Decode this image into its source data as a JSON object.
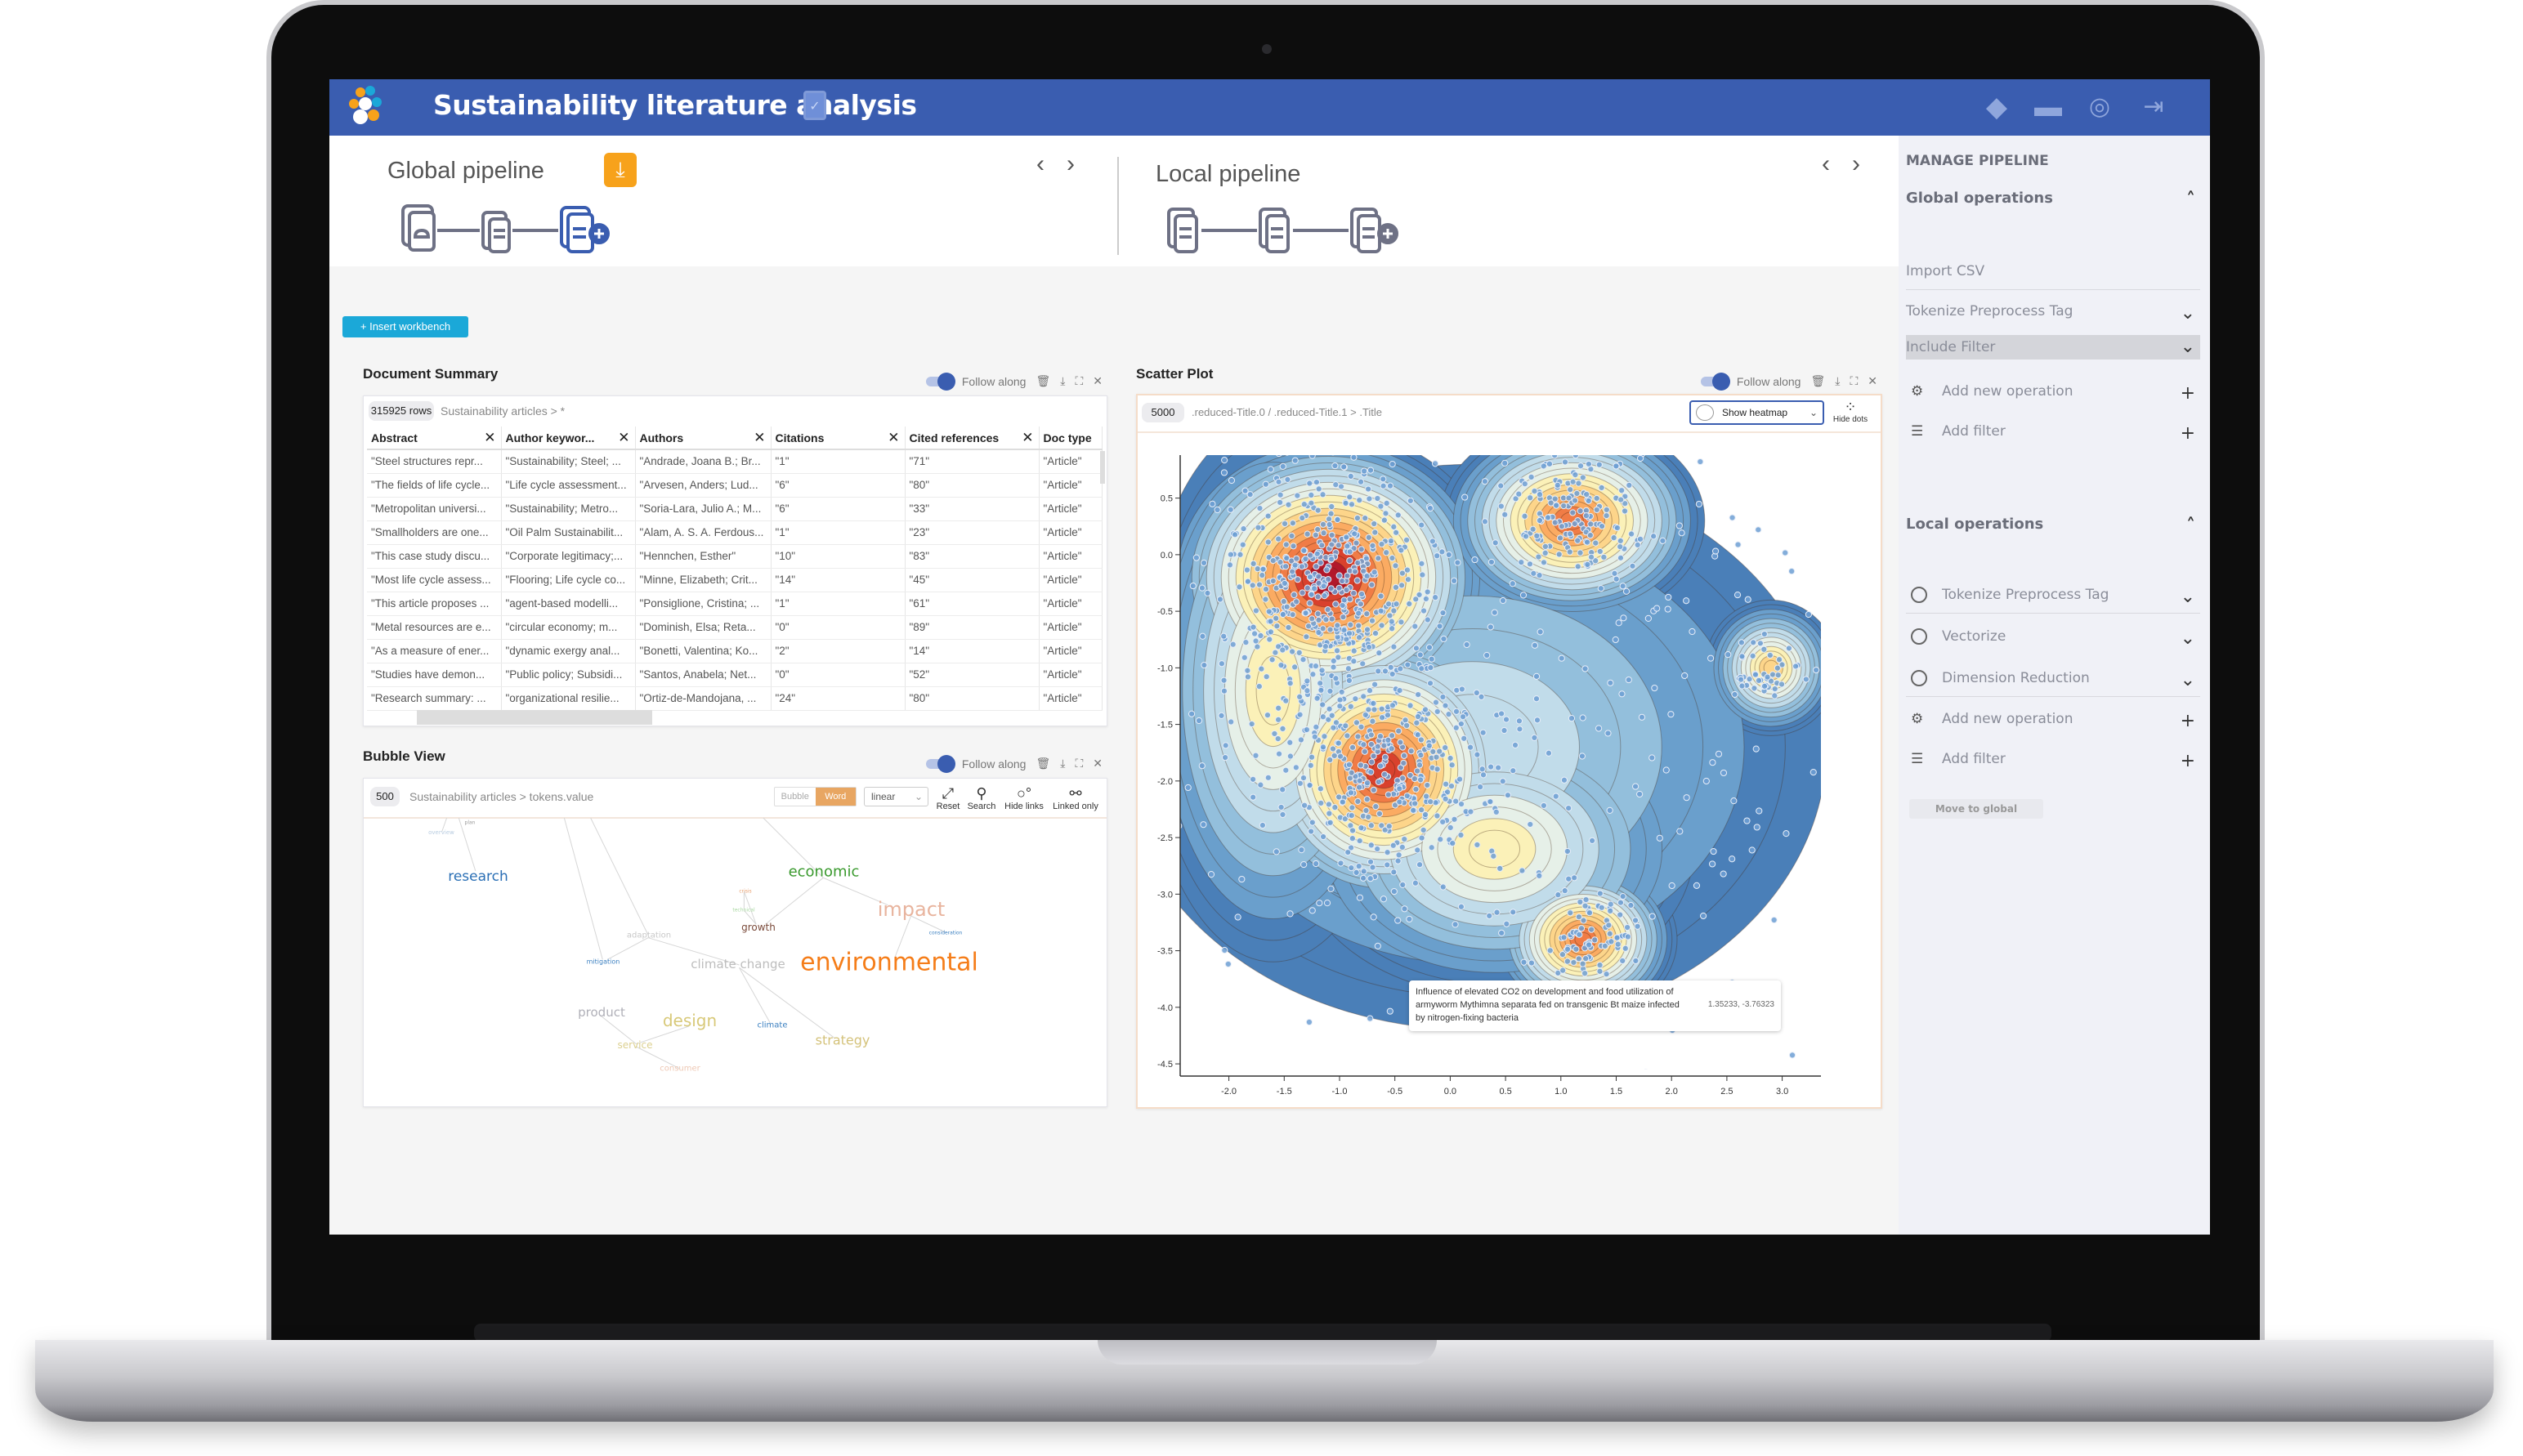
{
  "header": {
    "title": "Sustainability literature analysis",
    "icons": [
      "logo-icon",
      "workspace-check-icon",
      "layers-icon",
      "folder-icon",
      "user-icon",
      "logout-icon"
    ],
    "color": "#3a5db0"
  },
  "global_pipeline": {
    "title": "Global pipeline",
    "download_color": "#f7a21b"
  },
  "local_pipeline": {
    "title": "Local pipeline"
  },
  "insert_workbench": "+ Insert workbench",
  "panel_controls": {
    "follow_along": "Follow along"
  },
  "document_summary": {
    "title": "Document Summary",
    "rows_badge": "315925 rows",
    "crumb": "Sustainability articles  >  *",
    "columns": [
      "Abstract",
      "Author keywor...",
      "Authors",
      "Citations",
      "Cited references",
      "Doc type"
    ],
    "rows": [
      [
        "\"Steel structures repr...",
        "\"Sustainability; Steel; ...",
        "\"Andrade, Joana B.; Br...",
        "\"1\"",
        "\"71\"",
        "\"Article\""
      ],
      [
        "\"The fields of life cycle...",
        "\"Life cycle assessment...",
        "\"Arvesen, Anders; Lud...",
        "\"6\"",
        "\"80\"",
        "\"Article\""
      ],
      [
        "\"Metropolitan universi...",
        "\"Sustainability; Metro...",
        "\"Soria-Lara, Julio A.; M...",
        "\"6\"",
        "\"33\"",
        "\"Article\""
      ],
      [
        "\"Smallholders are one...",
        "\"Oil Palm Sustainabilit...",
        "\"Alam, A. S. A. Ferdous...",
        "\"1\"",
        "\"23\"",
        "\"Article\""
      ],
      [
        "\"This case study discu...",
        "\"Corporate legitimacy;...",
        "\"Hennchen, Esther\"",
        "\"10\"",
        "\"83\"",
        "\"Article\""
      ],
      [
        "\"Most life cycle assess...",
        "\"Flooring; Life cycle co...",
        "\"Minne, Elizabeth; Crit...",
        "\"14\"",
        "\"45\"",
        "\"Article\""
      ],
      [
        "\"This article proposes ...",
        "\"agent-based modelli...",
        "\"Ponsiglione, Cristina; ...",
        "\"1\"",
        "\"61\"",
        "\"Article\""
      ],
      [
        "\"Metal resources are e...",
        "\"circular economy; m...",
        "\"Dominish, Elsa; Reta...",
        "\"0\"",
        "\"89\"",
        "\"Article\""
      ],
      [
        "\"As a measure of ener...",
        "\"dynamic exergy anal...",
        "\"Bonetti, Valentina; Ko...",
        "\"2\"",
        "\"14\"",
        "\"Article\""
      ],
      [
        "\"Studies have demon...",
        "\"Public policy; Subsidi...",
        "\"Santos, Anabela; Net...",
        "\"0\"",
        "\"52\"",
        "\"Article\""
      ],
      [
        "\"Research summary: ...",
        "\"organizational resilie...",
        "\"Ortiz-de-Mandojana, ...",
        "\"24\"",
        "\"80\"",
        "\"Article\""
      ]
    ]
  },
  "bubble_view": {
    "title": "Bubble View",
    "count_badge": "500",
    "crumb": "Sustainability articles  >  tokens.value",
    "mode_options": [
      "Bubble",
      "Word"
    ],
    "mode_selected": "Word",
    "scale_select": "linear",
    "tools": [
      "Reset",
      "Search",
      "Hide links",
      "Linked only"
    ],
    "words": [
      {
        "text": "research",
        "color": "#2a6fb5",
        "size": 17
      },
      {
        "text": "economic",
        "color": "#3a9a2e",
        "size": 18
      },
      {
        "text": "impact",
        "color": "#e8b49e",
        "size": 24
      },
      {
        "text": "growth",
        "color": "#7a4a3a",
        "size": 12
      },
      {
        "text": "adaptation",
        "color": "#c8c8c8",
        "size": 10
      },
      {
        "text": "mitigation",
        "color": "#3a7fc0",
        "size": 8
      },
      {
        "text": "climate change",
        "color": "#bdbdbd",
        "size": 15
      },
      {
        "text": "environmental",
        "color": "#f57d19",
        "size": 30
      },
      {
        "text": "product",
        "color": "#b0b0b8",
        "size": 15
      },
      {
        "text": "design",
        "color": "#d8c979",
        "size": 20
      },
      {
        "text": "climate",
        "color": "#3a7fc0",
        "size": 10
      },
      {
        "text": "strategy",
        "color": "#d4c27a",
        "size": 16
      },
      {
        "text": "service",
        "color": "#dcd090",
        "size": 12
      },
      {
        "text": "consumer",
        "color": "#eec8b4",
        "size": 10
      },
      {
        "text": "crisis",
        "color": "#e8a070",
        "size": 6
      },
      {
        "text": "technical",
        "color": "#a8d8a0",
        "size": 6
      },
      {
        "text": "consideration",
        "color": "#3a7fc0",
        "size": 6
      },
      {
        "text": "plan",
        "color": "#999999",
        "size": 6
      },
      {
        "text": "overview",
        "color": "#b8cce0",
        "size": 7
      }
    ]
  },
  "scatter_plot": {
    "title": "Scatter Plot",
    "count_badge": "5000",
    "crumb": ".reduced-Title.0  /  .reduced-Title.1  >  .Title",
    "heatmap_select": "Show heatmap",
    "hide_dots": "Hide dots",
    "tooltip": {
      "text": "Influence of elevated CO2 on development and food utilization of armyworm Mythimna separata fed on transgenic Bt maize infected by nitrogen-fixing bacteria",
      "coords": "1.35233, -3.76323"
    }
  },
  "chart_data": {
    "type": "scatter",
    "overlay": "density contour heatmap",
    "point_color": "#6d9fd4",
    "colormap": [
      "#4a7fb8",
      "#6a9fcc",
      "#93bfdc",
      "#c1dcea",
      "#e6f0e8",
      "#fbf1b8",
      "#fdd58a",
      "#fbab62",
      "#f07c46",
      "#d9412d",
      "#b2182b"
    ],
    "xlim": [
      -2.44,
      3.35
    ],
    "ylim": [
      -4.55,
      0.88
    ],
    "x_ticks": [
      "-2.0",
      "-1.5",
      "-1.0",
      "-0.5",
      "0.0",
      "0.5",
      "1.0",
      "1.5",
      "2.0",
      "2.5",
      "3.0"
    ],
    "y_ticks": [
      "0.5",
      "0.0",
      "-0.5",
      "-1.0",
      "-1.5",
      "-2.0",
      "-2.5",
      "-3.0",
      "-3.5",
      "-4.0",
      "-4.5"
    ],
    "grid": false,
    "highlighted_point": [
      1.35233,
      -3.76323
    ]
  },
  "sidebar": {
    "title": "MANAGE PIPELINE",
    "global": {
      "title": "Global operations",
      "items": [
        "Import CSV",
        "Tokenize Preprocess Tag",
        "Include Filter"
      ],
      "add_op": "Add new operation",
      "add_filter": "Add filter"
    },
    "local": {
      "title": "Local operations",
      "items": [
        "Tokenize Preprocess Tag",
        "Vectorize",
        "Dimension Reduction"
      ],
      "add_op": "Add new operation",
      "add_filter": "Add filter"
    },
    "move_to_global": "Move to global"
  }
}
